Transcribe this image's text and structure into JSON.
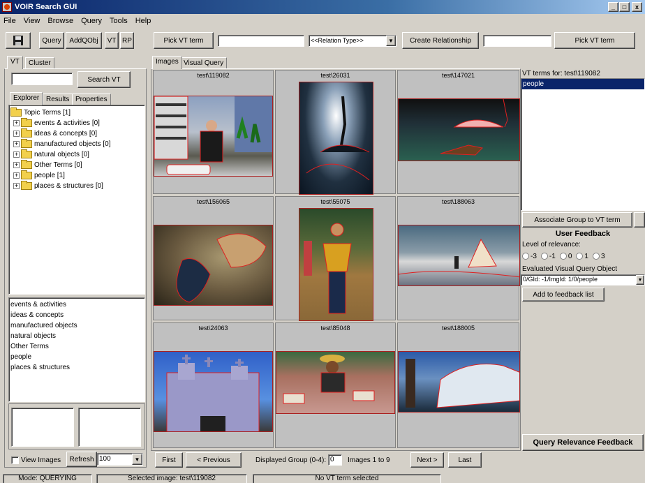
{
  "window": {
    "title": "VOIR Search GUI",
    "controls": [
      "_",
      "□",
      "x"
    ]
  },
  "menu": [
    "File",
    "View",
    "Browse",
    "Query",
    "Tools",
    "Help"
  ],
  "toolbar": {
    "query_label": "Query",
    "addqobj_label": "AddQObj",
    "vt_label": "VT",
    "rp_label": "RP",
    "pick_vt_left": "Pick VT term",
    "pick_vt_left_value": "",
    "relation_type": "<<Relation Type>>",
    "create_relationship": "Create Relationship",
    "pick_vt_right_value": "",
    "pick_vt_right": "Pick VT term"
  },
  "left": {
    "tabs": [
      "VT",
      "Cluster"
    ],
    "search_value": "",
    "search_button": "Search VT",
    "subtabs": [
      "Explorer",
      "Results",
      "Properties"
    ],
    "tree": {
      "root": "Topic Terms [1]",
      "children": [
        "events & activities [0]",
        "ideas & concepts [0]",
        "manufactured objects [0]",
        "natural objects [0]",
        "Other Terms [0]",
        "people [1]",
        "places & structures [0]"
      ]
    },
    "list": [
      "events & activities",
      "ideas & concepts",
      "manufactured objects",
      "natural objects",
      "Other Terms",
      "people",
      "places & structures"
    ],
    "view_images": "View Images",
    "refresh": "Refresh",
    "count_value": "100"
  },
  "center": {
    "tabs": [
      "Images",
      "Visual Query"
    ],
    "thumbs": [
      "test\\119082",
      "test\\26031",
      "test\\147021",
      "test\\156065",
      "test\\55075",
      "test\\188063",
      "test\\24063",
      "test\\85048",
      "test\\188005"
    ],
    "nav": {
      "first": "First",
      "previous": "< Previous",
      "group_label": "Displayed Group (0-4):",
      "group_value": "0",
      "range": "Images 1 to 9",
      "next": "Next >",
      "last": "Last"
    }
  },
  "right": {
    "vt_terms_label": "VT terms for: test\\119082",
    "vt_terms": [
      "people"
    ],
    "associate_button": "Associate Group to VT term",
    "feedback_title": "User Feedback",
    "relevance_label": "Level of relevance:",
    "relevance_options": [
      "-3",
      "-1",
      "0",
      "1",
      "3"
    ],
    "evaluated_label": "Evaluated Visual Query Object",
    "evaluated_value": "0/GId: -1/ImgId: 1/0/people",
    "add_feedback": "Add to feedback list",
    "qrf_button": "Query Relevance Feedback"
  },
  "status": {
    "mode": "Mode: QUERYING",
    "selected_image": "Selected image: test\\119082",
    "vt_term": "No VT term selected"
  },
  "colors": {
    "face": "#d4d0c8",
    "title_start": "#0a246a",
    "selection": "#0a246a",
    "region_outline": "#e02020"
  }
}
